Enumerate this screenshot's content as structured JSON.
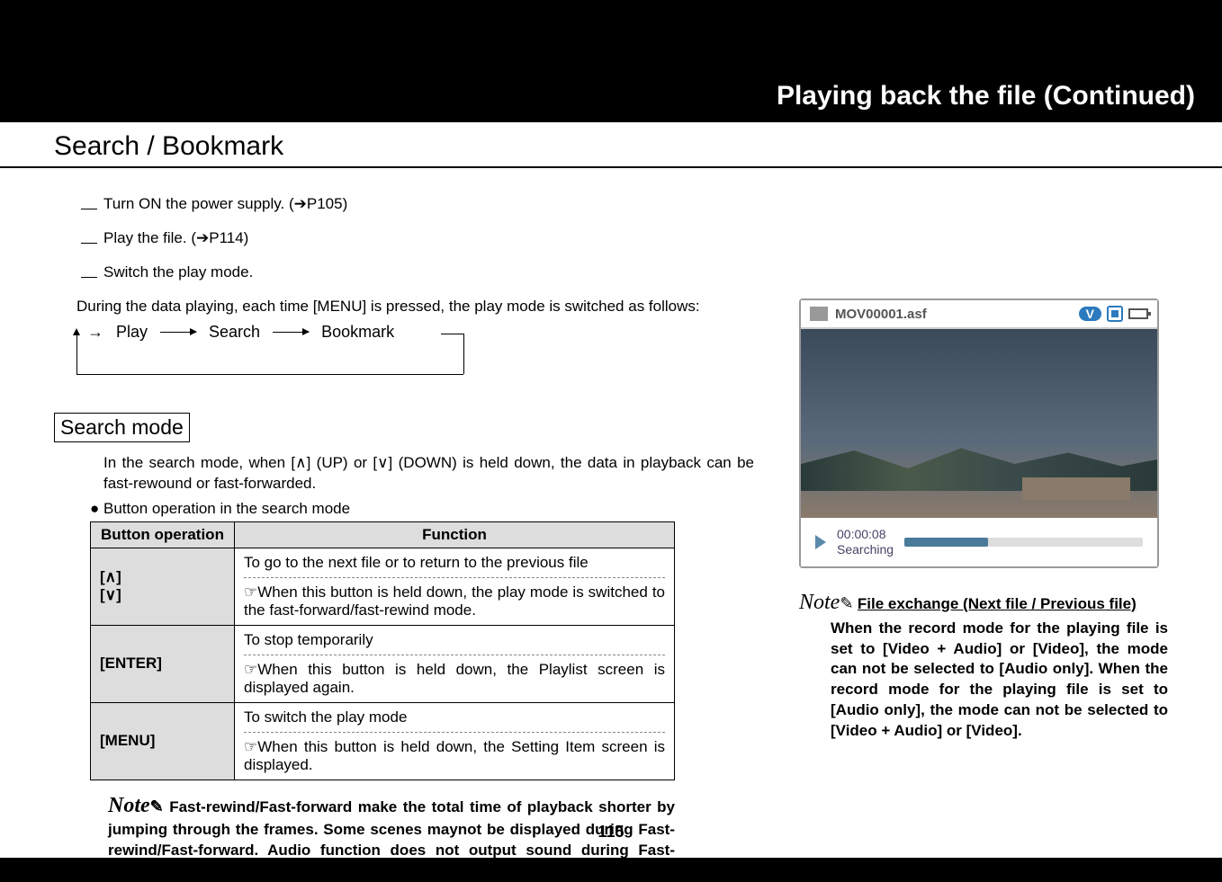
{
  "header": {
    "title": "Playing back the file (Continued)"
  },
  "section": "Search / Bookmark",
  "steps": {
    "s1": "Turn ON the power supply. (➔P105)",
    "s2": "Play the file. (➔P114)",
    "s3": "Switch the play mode.",
    "s3_sub": "During the data playing, each time [MENU] is pressed, the play mode is switched as follows:"
  },
  "flow": {
    "a": "Play",
    "b": "Search",
    "c": "Bookmark"
  },
  "search_mode": {
    "title": "Search mode",
    "desc": "In the search mode, when [∧] (UP) or [∨] (DOWN) is held down, the data in playback can be fast-rewound or fast-forwarded.",
    "bullet": "Button operation in the search mode"
  },
  "table": {
    "h1": "Button operation",
    "h2": "Function",
    "r1_btn": "[∧]\n[∨]",
    "r1_a": "To go to the next file or to return to the previous file",
    "r1_b": "☞When this button is held down, the play mode is switched to the fast-forward/fast-rewind mode.",
    "r2_btn": "[ENTER]",
    "r2_a": "To stop temporarily",
    "r2_b": "☞When this button is held down, the Playlist screen is displayed again.",
    "r3_btn": "[MENU]",
    "r3_a": "To switch the play mode",
    "r3_b": "☞When this button is held down, the Setting Item screen is displayed."
  },
  "note_left": "Fast-rewind/Fast-forward make the total time of playback shorter by jumping through the frames. Some scenes maynot be displayed during Fast-rewind/Fast-forward. Audio function does not output sound during Fast-rewind/Fast-forward.",
  "note_label": "Note",
  "screenshot": {
    "filename": "MOV00001.asf",
    "v_badge": "V",
    "time": "00:00:08",
    "status": "Searching"
  },
  "note_right": {
    "title": "File exchange (Next file / Previous file)",
    "body": "When the record mode for the playing file is set to [Video + Audio] or [Video], the mode can not be selected to [Audio only]. When the record mode for the playing file is set to [Audio only], the mode can not be selected to [Video + Audio] or [Video]."
  },
  "page_num": "115"
}
